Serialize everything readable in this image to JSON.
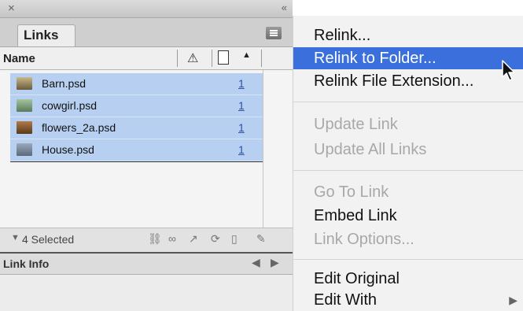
{
  "panel": {
    "close_glyph": "×",
    "collapse_glyph": "«",
    "tab_label": "Links",
    "column_name": "Name",
    "sort_glyph": "▲",
    "files": [
      {
        "name": "Barn.psd",
        "count": "1",
        "color": "#7a6a4a"
      },
      {
        "name": "cowgirl.psd",
        "count": "1",
        "color": "#6a8a6a"
      },
      {
        "name": "flowers_2a.psd",
        "count": "1",
        "color": "#7a4a2a"
      },
      {
        "name": "House.psd",
        "count": "1",
        "color": "#6a7a8a"
      }
    ],
    "status": {
      "disclosure": "▼",
      "selected_text": "4 Selected"
    },
    "link_info": {
      "label": "Link Info",
      "prev": "◀",
      "next": "▶"
    }
  },
  "menu": {
    "items": [
      {
        "label": "Relink...",
        "state": "enabled"
      },
      {
        "label": "Relink to Folder...",
        "state": "active"
      },
      {
        "label": "Relink File Extension...",
        "state": "enabled"
      },
      {
        "label": "Update Link",
        "state": "disabled"
      },
      {
        "label": "Update All Links",
        "state": "disabled"
      },
      {
        "label": "Go To Link",
        "state": "disabled"
      },
      {
        "label": "Embed Link",
        "state": "enabled"
      },
      {
        "label": "Link Options...",
        "state": "disabled"
      },
      {
        "label": "Edit Original",
        "state": "enabled"
      },
      {
        "label": "Edit With",
        "state": "enabled",
        "submenu": "▶"
      }
    ]
  },
  "colors": {
    "selection": "#b7d0f1",
    "menu_highlight": "#3b6fdb"
  }
}
